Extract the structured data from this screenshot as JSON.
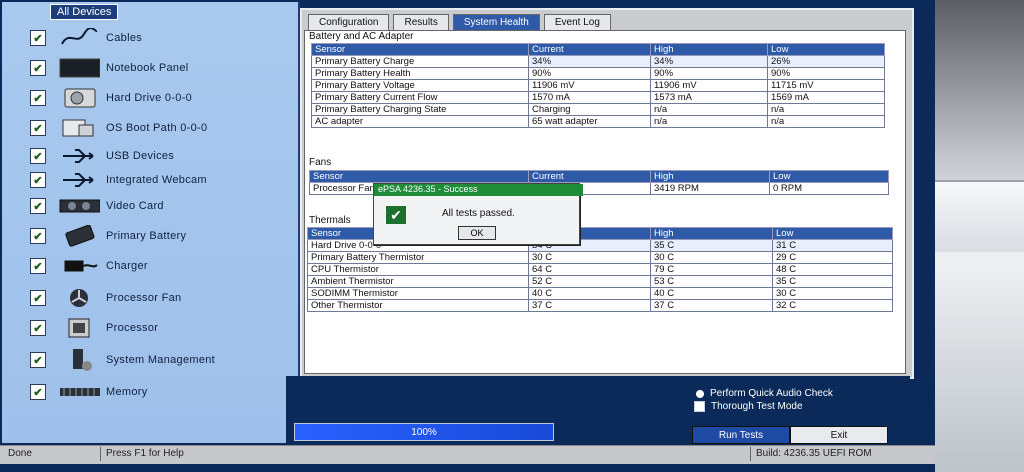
{
  "sidebar": {
    "title": "All Devices",
    "items": [
      {
        "label": "Cables",
        "icon": "cable-icon"
      },
      {
        "label": "Notebook Panel",
        "icon": "notebook-panel-icon"
      },
      {
        "label": "Hard Drive 0-0-0",
        "icon": "hard-drive-icon"
      },
      {
        "label": "OS Boot Path 0-0-0",
        "icon": "boot-path-icon"
      },
      {
        "label": "USB Devices",
        "icon": "usb-icon"
      },
      {
        "label": "Integrated Webcam",
        "icon": "usb-icon"
      },
      {
        "label": "Video Card",
        "icon": "video-card-icon"
      },
      {
        "label": "Primary Battery",
        "icon": "battery-icon"
      },
      {
        "label": "Charger",
        "icon": "charger-icon"
      },
      {
        "label": "Processor Fan",
        "icon": "fan-icon"
      },
      {
        "label": "Processor",
        "icon": "processor-icon"
      },
      {
        "label": "System Management",
        "icon": "system-management-icon"
      },
      {
        "label": "Memory",
        "icon": "memory-icon"
      }
    ]
  },
  "tabs": [
    {
      "label": "Configuration"
    },
    {
      "label": "Results"
    },
    {
      "label": "System Health"
    },
    {
      "label": "Event Log"
    }
  ],
  "battery_section": {
    "title": "Battery and AC Adapter",
    "headers": [
      "Sensor",
      "Current",
      "High",
      "Low"
    ],
    "rows": [
      [
        "Primary Battery Charge",
        "34%",
        "34%",
        "26%"
      ],
      [
        "Primary Battery Health",
        "90%",
        "90%",
        "90%"
      ],
      [
        "Primary Battery Voltage",
        "11906 mV",
        "11906 mV",
        "11715 mV"
      ],
      [
        "Primary Battery Current Flow",
        "1570 mA",
        "1573 mA",
        "1569 mA"
      ],
      [
        "Primary Battery Charging State",
        "Charging",
        "n/a",
        "n/a"
      ],
      [
        "AC adapter",
        "65 watt adapter",
        "n/a",
        "n/a"
      ]
    ]
  },
  "fans_section": {
    "title": "Fans",
    "headers": [
      "Sensor",
      "Current",
      "High",
      "Low"
    ],
    "rows": [
      [
        "Processor Fan",
        "",
        "3419 RPM",
        "0 RPM"
      ]
    ]
  },
  "thermals_section": {
    "title": "Thermals",
    "headers": [
      "Sensor",
      "Current",
      "High",
      "Low"
    ],
    "rows": [
      [
        "Hard Drive 0-0-0",
        "34 C",
        "35 C",
        "31 C"
      ],
      [
        "Primary Battery Thermistor",
        "30 C",
        "30 C",
        "29 C"
      ],
      [
        "CPU Thermistor",
        "64 C",
        "79 C",
        "48 C"
      ],
      [
        "Ambient Thermistor",
        "52 C",
        "53 C",
        "35 C"
      ],
      [
        "SODIMM Thermistor",
        "40 C",
        "40 C",
        "30 C"
      ],
      [
        "Other Thermistor",
        "37 C",
        "37 C",
        "32 C"
      ]
    ]
  },
  "popup": {
    "title": "ePSA 4236.35 - Success",
    "message": "All tests passed.",
    "ok_label": "OK"
  },
  "progress": {
    "label": "100%",
    "value": 1.0
  },
  "options": {
    "quick_audio": "Perform Quick Audio Check",
    "thorough": "Thorough Test Mode"
  },
  "buttons": {
    "run": "Run Tests",
    "exit": "Exit"
  },
  "status_bar": {
    "left": "Done",
    "help": "Press F1 for Help",
    "build": "Build: 4236.35 UEFI ROM"
  }
}
